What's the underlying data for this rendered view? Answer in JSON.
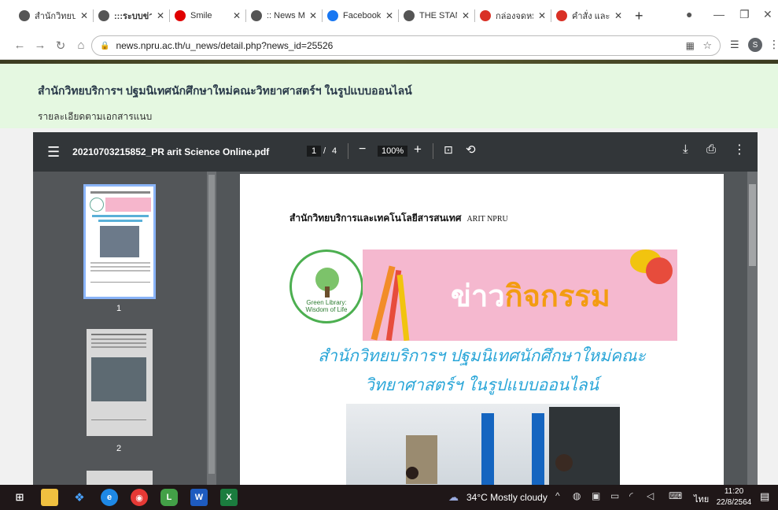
{
  "browser": {
    "tabs": [
      {
        "label": "สำนักวิทยบริก",
        "favicon_color": "#555555"
      },
      {
        "label": ":::ระบบข่าวประ",
        "favicon_color": "#555555",
        "active": true
      },
      {
        "label": "Smile",
        "favicon_color": "#e00000"
      },
      {
        "label": ":: News Ma",
        "favicon_color": "#555555"
      },
      {
        "label": "Facebook",
        "favicon_color": "#1877f2"
      },
      {
        "label": "THE STAND",
        "favicon_color": "#555555"
      },
      {
        "label": "กล่องจดหมาย",
        "favicon_color": "#d93025"
      },
      {
        "label": "คำสั่ง และราย",
        "favicon_color": "#d93025"
      }
    ],
    "new_tab": "+",
    "url": "news.npru.ac.th/u_news/detail.php?news_id=25526"
  },
  "page": {
    "title": "สำนักวิทยบริการฯ ปฐมนิเทศนักศึกษาใหม่คณะวิทยาศาสตร์ฯ ในรูปแบบออนไลน์",
    "subtitle": "รายละเอียดตามเอกสารแนบ"
  },
  "pdf": {
    "filename": "20210703215852_PR arit Science Online.pdf",
    "current_page": "1",
    "page_sep": "/",
    "total_pages": "4",
    "zoom": "100%",
    "thumbnails": [
      {
        "number": "1",
        "selected": true
      },
      {
        "number": "2",
        "selected": false
      }
    ],
    "page1": {
      "header": "สำนักวิทยบริการและเทคโนโลยีสารสนเทศ",
      "header_en": "ARIT NPRU",
      "banner_text_a": "ข่าว",
      "banner_text_b": "กิจกรรม",
      "logo_caption_1": "Green Library:",
      "logo_caption_2": "Wisdom of Life",
      "headline_1": "สำนักวิทยบริการฯ ปฐมนิเทศนักศึกษาใหม่คณะ",
      "headline_2": "วิทยาศาสตร์ฯ ในรูปแบบออนไลน์"
    }
  },
  "taskbar": {
    "weather": "34°C  Mostly cloudy",
    "language": "ไทย",
    "time": "11:20",
    "date": "22/8/2564"
  }
}
